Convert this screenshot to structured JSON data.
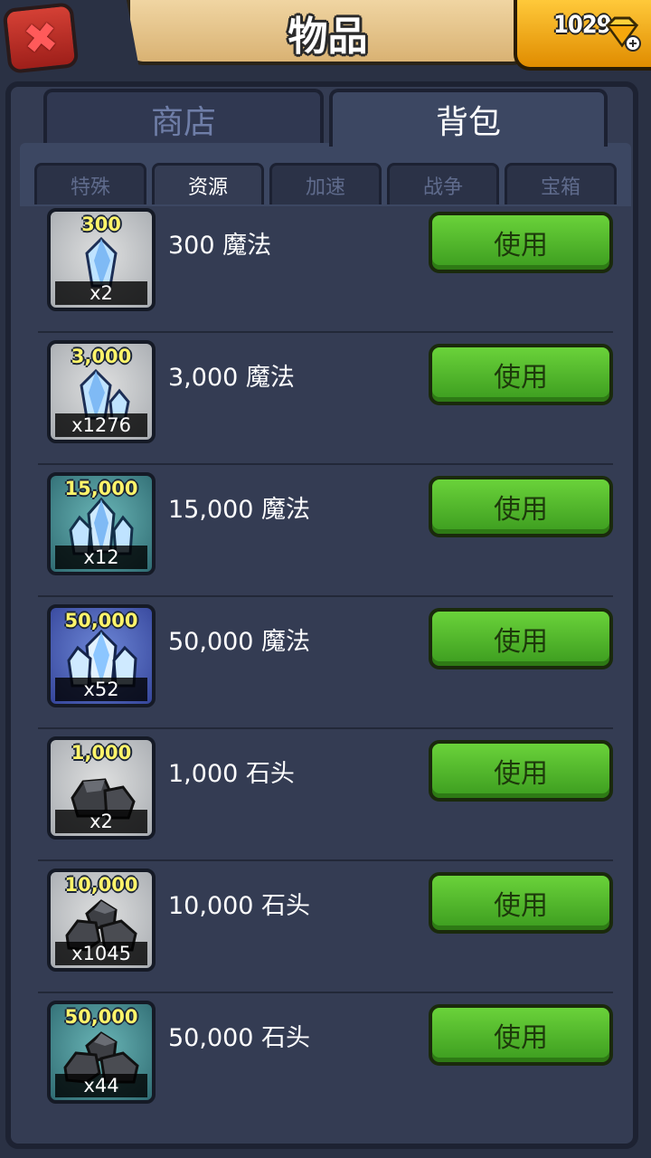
{
  "header": {
    "title": "物品",
    "gems": "1029"
  },
  "icons": {
    "close": "close-icon",
    "gem": "gem-icon"
  },
  "main_tabs": [
    {
      "label": "商店",
      "active": false
    },
    {
      "label": "背包",
      "active": true
    }
  ],
  "sub_tabs": [
    {
      "label": "特殊",
      "active": false
    },
    {
      "label": "资源",
      "active": true
    },
    {
      "label": "加速",
      "active": false
    },
    {
      "label": "战争",
      "active": false
    },
    {
      "label": "宝箱",
      "active": false
    }
  ],
  "items": [
    {
      "amount": "300",
      "qty": "x2",
      "name": "300 魔法",
      "button": "使用"
    },
    {
      "amount": "3,000",
      "qty": "x1276",
      "name": "3,000 魔法",
      "button": "使用"
    },
    {
      "amount": "15,000",
      "qty": "x12",
      "name": "15,000 魔法",
      "button": "使用"
    },
    {
      "amount": "50,000",
      "qty": "x52",
      "name": "50,000 魔法",
      "button": "使用"
    },
    {
      "amount": "1,000",
      "qty": "x2",
      "name": "1,000 石头",
      "button": "使用"
    },
    {
      "amount": "10,000",
      "qty": "x1045",
      "name": "10,000 石头",
      "button": "使用"
    },
    {
      "amount": "50,000",
      "qty": "x44",
      "name": "50,000 石头",
      "button": "使用"
    }
  ],
  "colors": {
    "accent_green": "#4fb82b",
    "gem_gold": "#f5b21a",
    "close_red": "#c8352c"
  }
}
